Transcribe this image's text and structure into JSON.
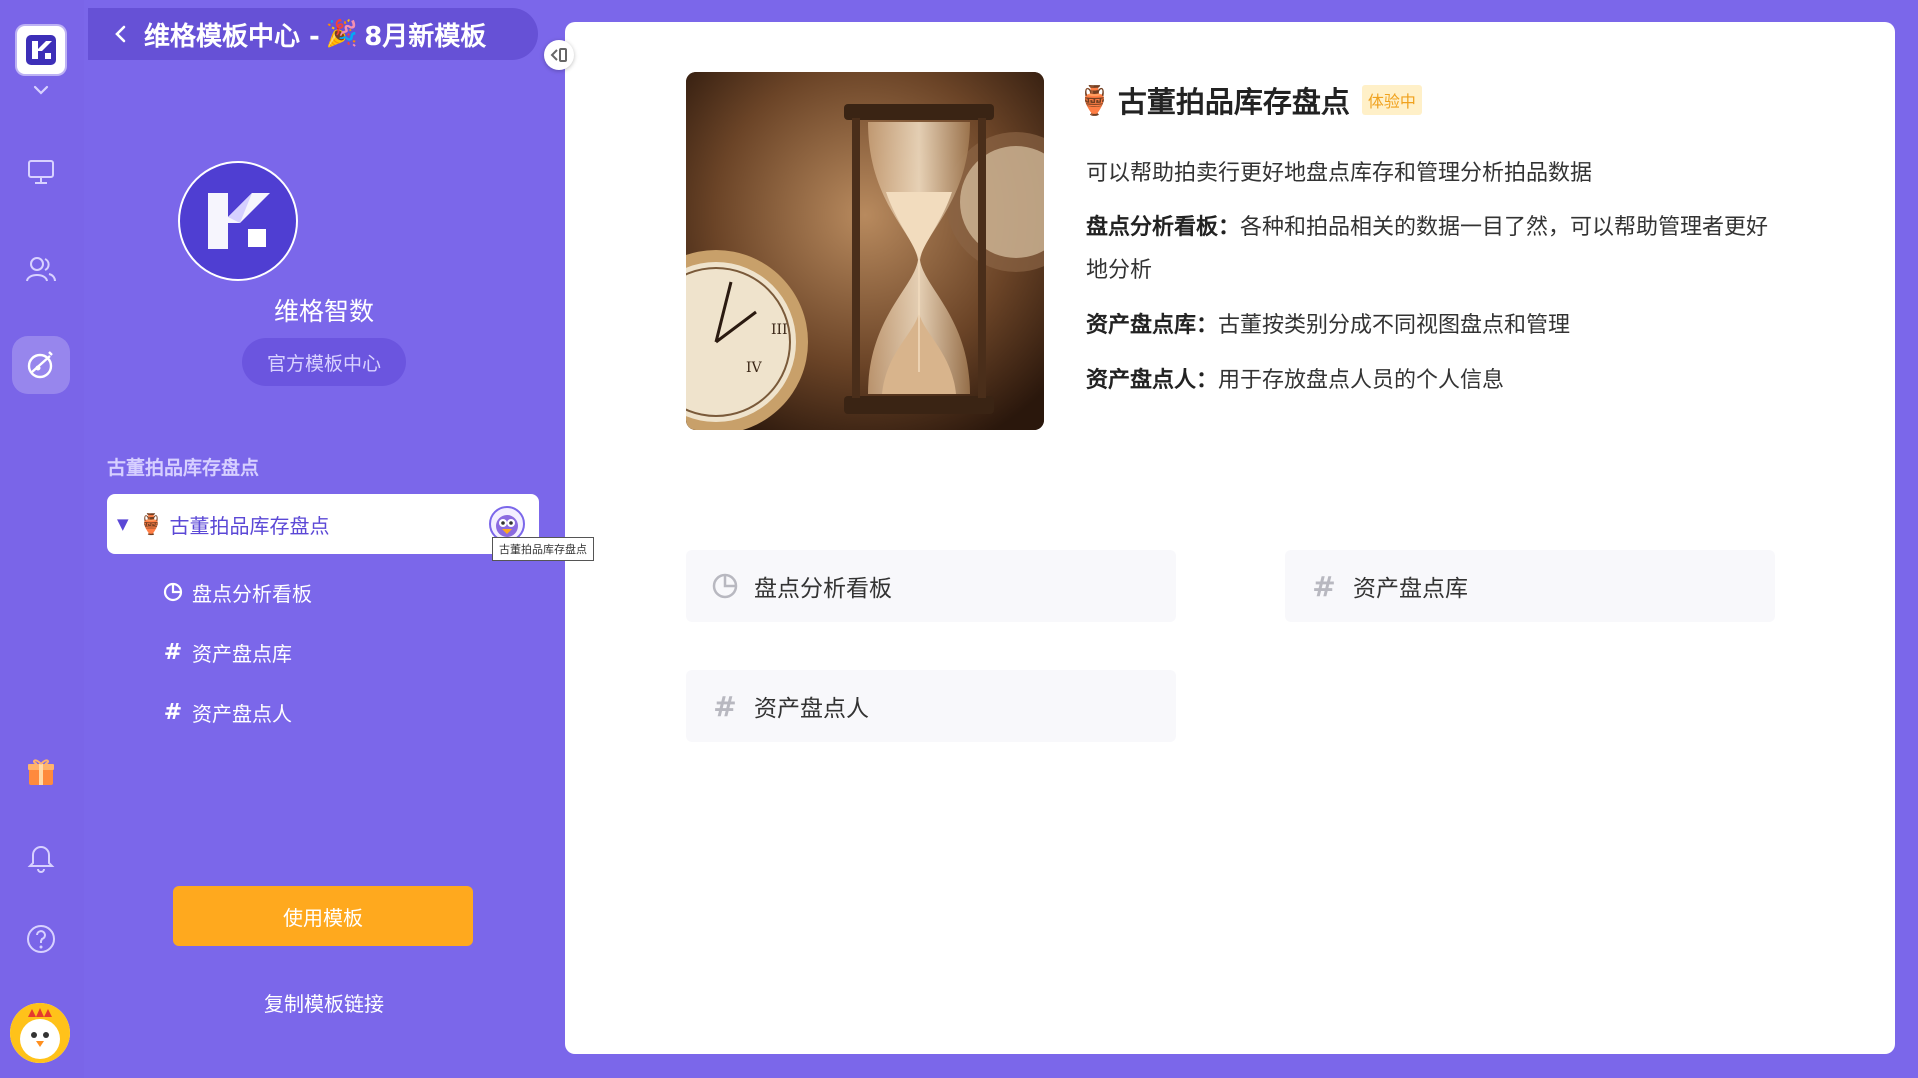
{
  "header": {
    "back_icon": "chevron-left-icon",
    "title": "维格模板中心 -",
    "party_icon": "🎉",
    "subtitle": "8月新模板"
  },
  "brand": {
    "name": "维格智数",
    "chip": "官方模板中心"
  },
  "template": {
    "section_title": "古董拍品库存盘点",
    "root_label": "古董拍品库存盘点",
    "root_icon": "🏺",
    "tooltip": "古董拍品库存盘点",
    "children": [
      {
        "label": "盘点分析看板",
        "icon": "dashboard-icon"
      },
      {
        "label": "资产盘点库",
        "icon": "hash-icon"
      },
      {
        "label": "资产盘点人",
        "icon": "hash-icon"
      }
    ],
    "use_button": "使用模板",
    "copy_link": "复制模板链接"
  },
  "main": {
    "icon": "🏺",
    "title": "古董拍品库存盘点",
    "badge": "体验中",
    "intro": "可以帮助拍卖行更好地盘点库存和管理分析拍品数据",
    "items": [
      {
        "name": "盘点分析看板：",
        "text": "各种和拍品相关的数据一目了然，可以帮助管理者更好地分析"
      },
      {
        "name": "资产盘点库：",
        "text": "古董按类别分成不同视图盘点和管理"
      },
      {
        "name": "资产盘点人：",
        "text": "用于存放盘点人员的个人信息"
      }
    ],
    "views": [
      {
        "label": "盘点分析看板",
        "icon": "dashboard-icon"
      },
      {
        "label": "资产盘点库",
        "icon": "hash-icon"
      },
      {
        "label": "资产盘点人",
        "icon": "hash-icon"
      }
    ]
  },
  "colors": {
    "accent": "#7b67ea",
    "button": "#ffa91e",
    "badge_bg": "#fff0c8"
  }
}
